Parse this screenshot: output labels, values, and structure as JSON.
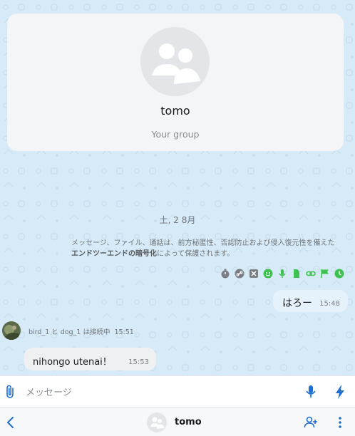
{
  "group": {
    "name": "tomo",
    "subtitle": "Your group"
  },
  "chat": {
    "date": "土, 2 8月",
    "e2e_notice_part1": "メッセージ、ファイル、通話は、前方秘匿性、否認防止および侵入復元性を備えた",
    "e2e_notice_bold": "エンドツーエンドの暗号化",
    "e2e_notice_part2": "によって保護されます。",
    "icons": [
      "timer-icon",
      "link-circle-icon",
      "close-square-icon",
      "emoji-add-icon",
      "mic-icon",
      "file-icon",
      "link-icon",
      "flag-icon",
      "clock-icon"
    ],
    "outgoing": {
      "text": "はろー",
      "time": "15:48"
    },
    "join": {
      "users": "bird_1 と dog_1 は接続中",
      "time": "15:51"
    },
    "incoming": {
      "text": "nihongo utenai！",
      "time": "15:53"
    }
  },
  "input": {
    "placeholder": "メッセージ"
  },
  "nav": {
    "title": "tomo"
  },
  "colors": {
    "accent": "#1f6fd1",
    "green": "#3ec24f",
    "bubble_out": "#e6f2fb"
  }
}
